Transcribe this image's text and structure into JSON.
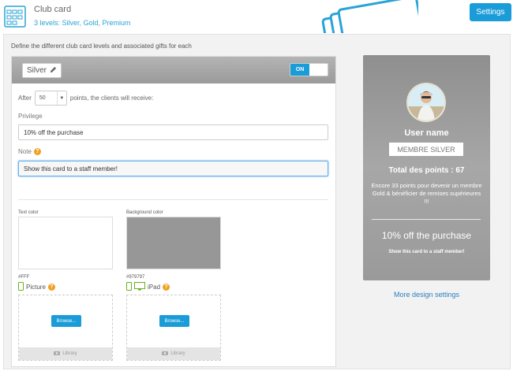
{
  "header": {
    "title": "Club card",
    "subtitle": "3 levels: Silver, Gold, Premium",
    "settings_label": "Settings"
  },
  "main": {
    "intro": "Define the different club card levels and associated gifts for each"
  },
  "level": {
    "name": "Silver",
    "toggle_label": "ON",
    "enabled": true,
    "after_prefix": "After",
    "points_value": "50",
    "after_suffix": "points, the clients will receive:",
    "privilege_label": "Privilege",
    "privilege_value": "10% off the purchase",
    "note_label": "Note",
    "note_value": "Show this card to a staff member!",
    "text_color_label": "Text color",
    "text_color_value": "#FFF",
    "bg_color_label": "Background color",
    "bg_color_value": "#979797",
    "picture_label": "Picture",
    "ipad_label": "iPad",
    "browse_label": "Browse...",
    "library_label": "Library"
  },
  "preview": {
    "user_name": "User name",
    "member_label": "MEMBRE SILVER",
    "total_points": "Total des points : 67",
    "encore_text": "Encore 33 points pour devenir un membre Gold & bénéficier de remises supérieures !!!",
    "privilege": "10% off the purchase",
    "note": "Show this card to a staff member!"
  },
  "more_design_label": "More design settings",
  "colors": {
    "accent": "#1a9cd8",
    "card_bg": "#979797",
    "text": "#FFF",
    "help": "#f0a020",
    "device": "#6ab023"
  }
}
